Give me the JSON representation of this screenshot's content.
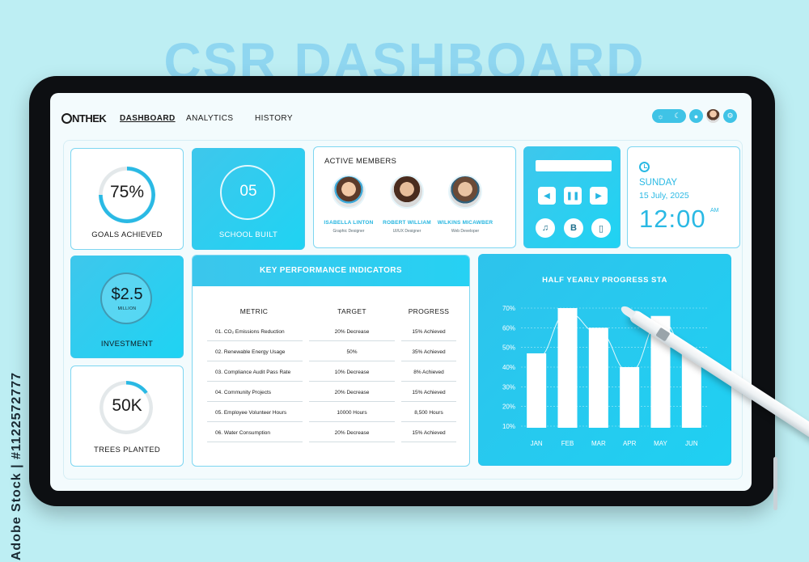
{
  "poster": {
    "title": "CSR DASHBOARD",
    "watermark": "Adobe Stock | #1122572777"
  },
  "header": {
    "logo": "NTHEK",
    "nav": [
      "DASHBOARD",
      "ANALYTICS",
      "HISTORY"
    ],
    "active_nav": "DASHBOARD"
  },
  "cards": {
    "goals": {
      "value": "75%",
      "label": "GOALS ACHIEVED",
      "progress": 0.75
    },
    "school": {
      "value": "05",
      "label": "SCHOOL BUILT"
    },
    "investment": {
      "value": "$2.5",
      "unit": "MILLION",
      "label": "INVESTMENT"
    },
    "trees": {
      "value": "50K",
      "label": "TREES PLANTED",
      "progress": 0.15
    }
  },
  "members": {
    "title": "ACTIVE MEMBERS",
    "list": [
      {
        "name": "ISABELLA LINTON",
        "role": "Graphic Designer"
      },
      {
        "name": "ROBERT WILLIAM",
        "role": "UI/UX Designer"
      },
      {
        "name": "WILKINS MICAWBER",
        "role": "Web Developer"
      }
    ]
  },
  "player": {
    "circle_buttons": [
      "headphones-icon",
      "B",
      "phone-icon"
    ]
  },
  "datetime": {
    "day": "SUNDAY",
    "date": "15 July, 2025",
    "time": "12:00",
    "ampm": "AM"
  },
  "kpi": {
    "title": "KEY PERFORMANCE INDICATORS",
    "columns": [
      "METRIC",
      "TARGET",
      "PROGRESS"
    ],
    "rows": [
      {
        "metric": "01.  CO₂ Emissions Reduction",
        "target": "20% Decrease",
        "progress": "15% Achieved"
      },
      {
        "metric": "02.  Renewable Energy Usage",
        "target": "50%",
        "progress": "35% Achieved"
      },
      {
        "metric": "03.  Compliance Audit Pass Rate",
        "target": "10% Decrease",
        "progress": "8% Achieved"
      },
      {
        "metric": "04.  Community Projects",
        "target": "20% Decrease",
        "progress": "15% Achieved"
      },
      {
        "metric": "05.  Employee Volunteer Hours",
        "target": "10000 Hours",
        "progress": "8,500 Hours"
      },
      {
        "metric": "06.  Water Consumption",
        "target": "20% Decrease",
        "progress": "15% Achieved"
      }
    ]
  },
  "chart_data": {
    "type": "bar",
    "title": "HALF YEARLY PROGRESS STA",
    "categories": [
      "JAN",
      "FEB",
      "MAR",
      "APR",
      "MAY",
      "JUN"
    ],
    "values": [
      47,
      70,
      60,
      40,
      66,
      47
    ],
    "yticks": [
      "10%",
      "20%",
      "30%",
      "40%",
      "50%",
      "60%",
      "70%"
    ],
    "ylim": [
      10,
      70
    ],
    "grid": true,
    "overlay_line": true
  },
  "colors": {
    "accent": "#2ab9e4",
    "accent_light": "#1fd3f3",
    "background": "#bdeef3"
  }
}
